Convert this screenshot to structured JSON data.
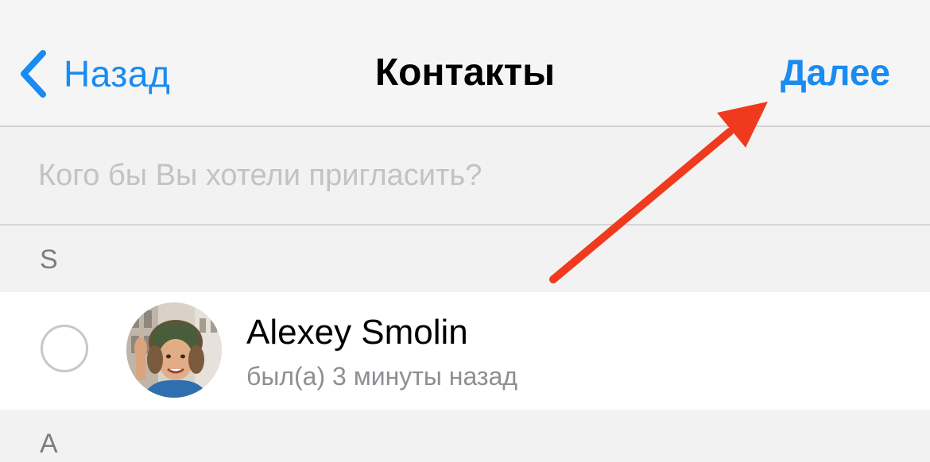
{
  "navbar": {
    "back_label": "Назад",
    "title": "Контакты",
    "next_label": "Далее",
    "accent_color": "#1a8bf0",
    "back_icon": "chevron-left-icon"
  },
  "search": {
    "placeholder": "Кого бы Вы хотели пригласить?",
    "value": ""
  },
  "sections": [
    {
      "letter": "S",
      "contacts": [
        {
          "name": "Alexey Smolin",
          "status": "был(а) 3 минуты назад",
          "selected": false,
          "avatar": "avatar-photo"
        }
      ]
    },
    {
      "letter": "A",
      "contacts": []
    }
  ],
  "annotation": {
    "type": "arrow",
    "color": "#f03a1e",
    "points_to": "next-button"
  }
}
